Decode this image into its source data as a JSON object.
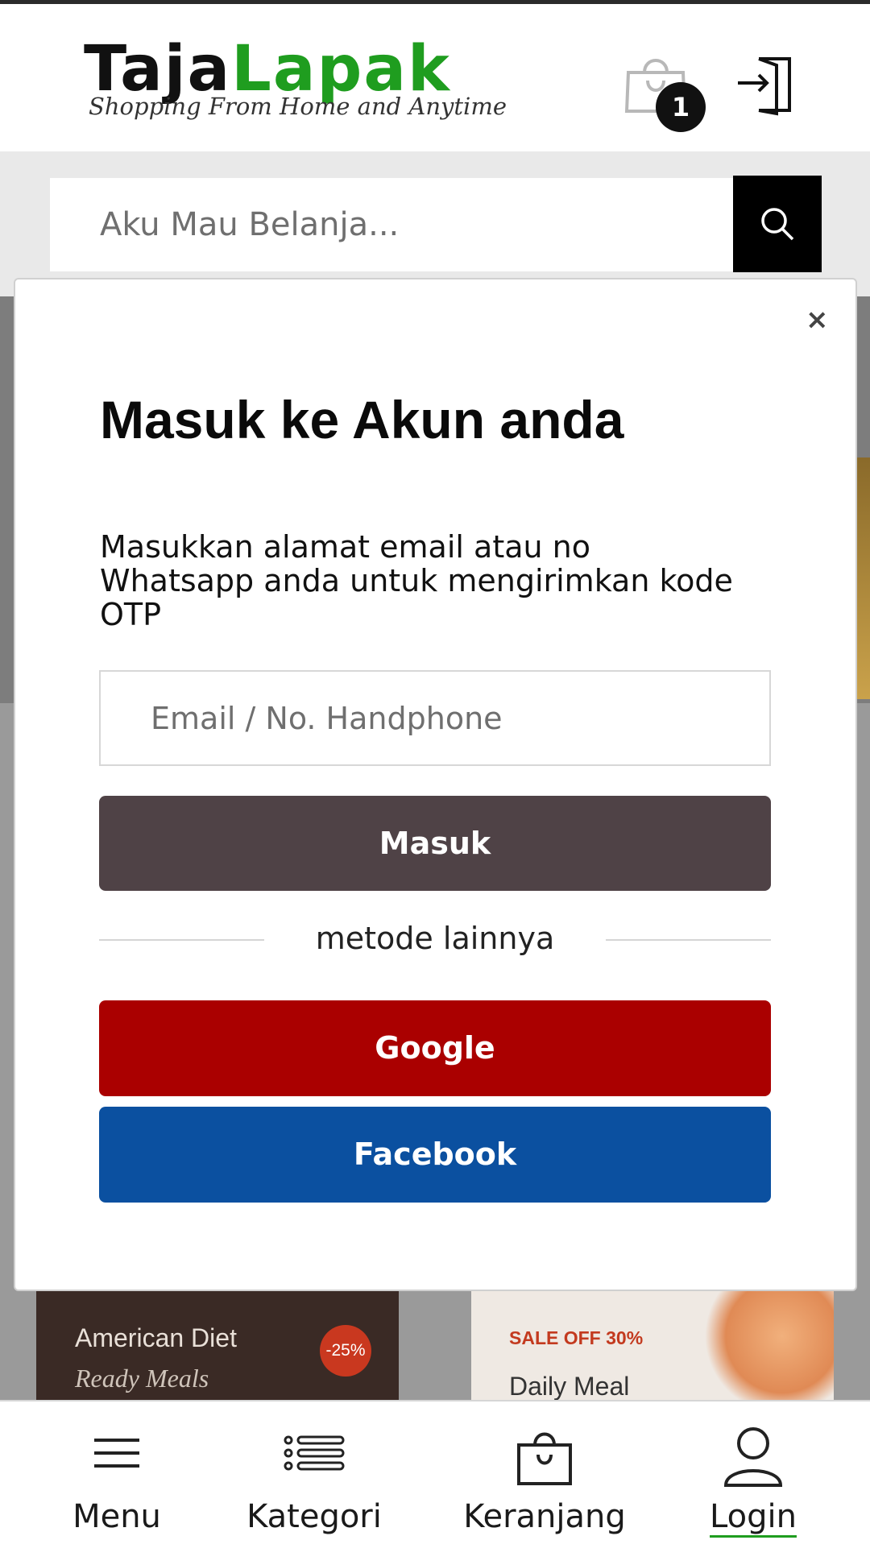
{
  "header": {
    "logo_part1": "Taja",
    "logo_part2": "Lapak",
    "logo_tagline": "Shopping From Home and Anytime",
    "cart_count": "1"
  },
  "search": {
    "placeholder": "Aku Mau Belanja..."
  },
  "background": {
    "card1_title": "American Diet",
    "card1_subtitle": "Ready Meals",
    "card1_badge": "-25%",
    "card2_sale": "SALE OFF 30%",
    "card2_title": "Daily Meal"
  },
  "modal": {
    "close_label": "×",
    "title": "Masuk ke Akun anda",
    "description": "Masukkan alamat email atau no Whatsapp anda untuk mengirimkan kode OTP",
    "input_placeholder": "Email / No. Handphone",
    "submit_label": "Masuk",
    "divider_text": "metode lainnya",
    "google_label": "Google",
    "facebook_label": "Facebook"
  },
  "bottom_nav": {
    "items": [
      {
        "label": "Menu",
        "icon": "hamburger-icon"
      },
      {
        "label": "Kategori",
        "icon": "list-icon"
      },
      {
        "label": "Keranjang",
        "icon": "shopping-bag-icon"
      },
      {
        "label": "Login",
        "icon": "user-icon"
      }
    ]
  },
  "colors": {
    "brand_green": "#1f9d1f",
    "masuk_button": "#4f4246",
    "google_button": "#aa0000",
    "facebook_button": "#0b50a0"
  }
}
